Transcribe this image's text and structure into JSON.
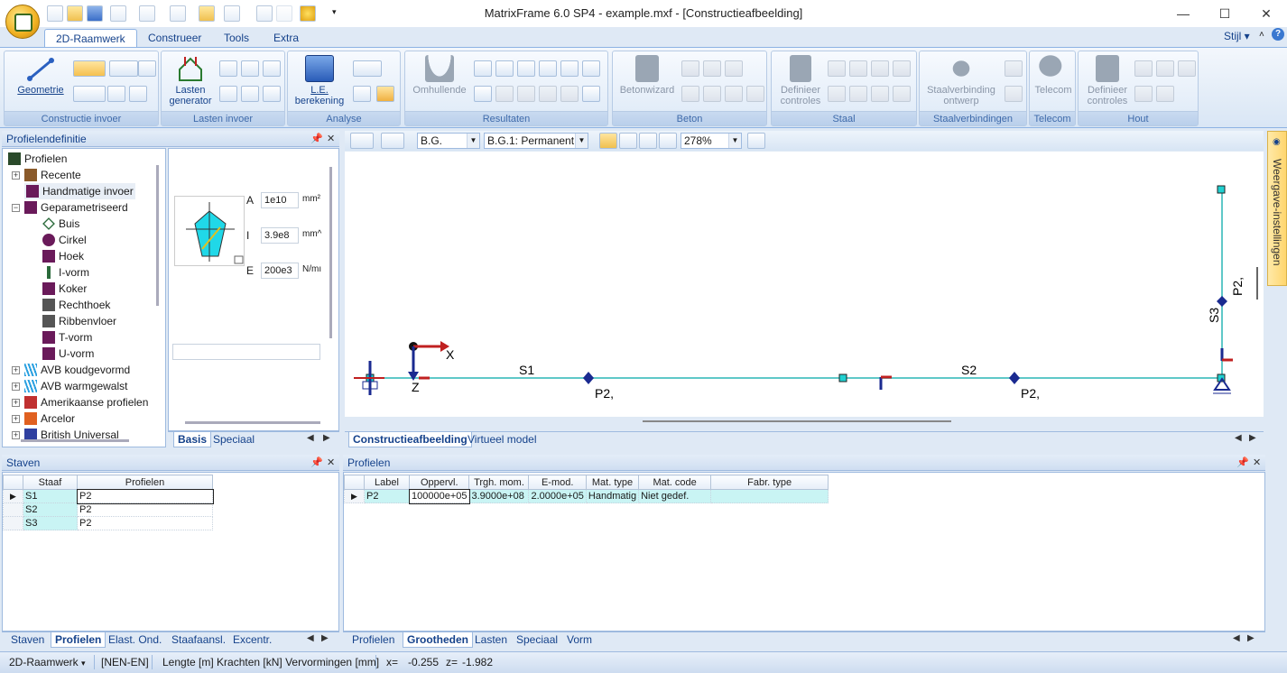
{
  "app": {
    "title": "MatrixFrame 6.0 SP4 - example.mxf - [Constructieafbeelding]",
    "stijl_label": "Stijl",
    "help_label": "?"
  },
  "window_controls": {
    "minimize": "—",
    "maximize": "☐",
    "close": "✕"
  },
  "ribbon_tabs": [
    {
      "label": "2D-Raamwerk",
      "active": true
    },
    {
      "label": "Construeer",
      "active": false
    },
    {
      "label": "Tools",
      "active": false
    },
    {
      "label": "Extra",
      "active": false
    }
  ],
  "ribbon_groups": {
    "constructie": {
      "label": "Constructie invoer",
      "big_button": "Geometrie"
    },
    "lasten": {
      "label": "Lasten invoer",
      "big_button_line1": "Lasten",
      "big_button_line2": "generator"
    },
    "analyse": {
      "label": "Analyse",
      "big_button_line1": "L.E.",
      "big_button_line2": "berekening"
    },
    "resultaten": {
      "label": "Resultaten",
      "big_button": "Omhullende"
    },
    "beton": {
      "label": "Beton",
      "big_button": "Betonwizard"
    },
    "staal": {
      "label": "Staal",
      "big_button_line1": "Definieer",
      "big_button_line2": "controles"
    },
    "staalverbindingen": {
      "label": "Staalverbindingen",
      "big_button_line1": "Staalverbinding",
      "big_button_line2": "ontwerp"
    },
    "telecom": {
      "label": "Telecom",
      "big_button": "Telecom"
    },
    "hout": {
      "label": "Hout",
      "big_button_line1": "Definieer",
      "big_button_line2": "controles"
    }
  },
  "profile_panel": {
    "title": "Profielendefinitie",
    "tree": [
      {
        "label": "Profielen",
        "level": 0,
        "icon": "profiles-grid-icon"
      },
      {
        "label": "Recente",
        "level": 1,
        "icon": "recent-icon",
        "expander": "+"
      },
      {
        "label": "Handmatige invoer",
        "level": 1,
        "icon": "manual-input-icon",
        "selected": true
      },
      {
        "label": "Geparametriseerd",
        "level": 1,
        "icon": "parametric-icon",
        "expander": "−"
      },
      {
        "label": "Buis",
        "level": 2,
        "icon": "tube-icon"
      },
      {
        "label": "Cirkel",
        "level": 2,
        "icon": "circle-icon"
      },
      {
        "label": "Hoek",
        "level": 2,
        "icon": "angle-icon"
      },
      {
        "label": "I-vorm",
        "level": 2,
        "icon": "i-shape-icon"
      },
      {
        "label": "Koker",
        "level": 2,
        "icon": "box-icon"
      },
      {
        "label": "Rechthoek",
        "level": 2,
        "icon": "rectangle-icon"
      },
      {
        "label": "Ribbenvloer",
        "level": 2,
        "icon": "ribbed-floor-icon"
      },
      {
        "label": "T-vorm",
        "level": 2,
        "icon": "t-shape-icon"
      },
      {
        "label": "U-vorm",
        "level": 2,
        "icon": "u-shape-icon"
      },
      {
        "label": "AVB koudgevormd",
        "level": 1,
        "icon": "cold-formed-icon",
        "expander": "+"
      },
      {
        "label": "AVB warmgewalst",
        "level": 1,
        "icon": "hot-rolled-icon",
        "expander": "+"
      },
      {
        "label": "Amerikaanse profielen",
        "level": 1,
        "icon": "us-flag-icon",
        "expander": "+"
      },
      {
        "label": "Arcelor",
        "level": 1,
        "icon": "arcelor-icon",
        "expander": "+"
      },
      {
        "label": "British Universal",
        "level": 1,
        "icon": "uk-flag-icon",
        "expander": "+"
      }
    ],
    "props": [
      {
        "key": "A",
        "value": "1e10",
        "unit": "mm²"
      },
      {
        "key": "I",
        "value": "3.9e8",
        "unit": "mm^"
      },
      {
        "key": "E",
        "value": "200e3",
        "unit": "N/mı"
      }
    ],
    "tabs": [
      {
        "label": "Basis",
        "active": true
      },
      {
        "label": "Speciaal",
        "active": false
      }
    ]
  },
  "view_toolbar": {
    "loadcase": "B.G.",
    "combination": "B.G.1: Permanent",
    "zoom": "278%"
  },
  "canvas": {
    "labels": {
      "s1": "S1",
      "s2": "S2",
      "s3": "S3",
      "p2a": "P2,",
      "p2b": "P2,",
      "p2c": "P2,",
      "x_axis": "X",
      "z_axis": "Z"
    }
  },
  "view_tabs": [
    {
      "label": "Constructieafbeelding",
      "active": true
    },
    {
      "label": "Virtueel model",
      "active": false
    }
  ],
  "right_sidebar": {
    "label": "Weergave-instellingen"
  },
  "staven_panel": {
    "title": "Staven",
    "columns": [
      "Staaf",
      "Profielen"
    ],
    "rows": [
      {
        "staaf": "S1",
        "profiel": "P2"
      },
      {
        "staaf": "S2",
        "profiel": "P2"
      },
      {
        "staaf": "S3",
        "profiel": "P2"
      }
    ],
    "tabs": [
      {
        "label": "Staven",
        "active": false
      },
      {
        "label": "Profielen",
        "active": true
      },
      {
        "label": "Elast. Ond.",
        "active": false
      },
      {
        "label": "Staafaansl.",
        "active": false
      },
      {
        "label": "Excentr.",
        "active": false
      }
    ]
  },
  "profielen_panel": {
    "title": "Profielen",
    "columns": [
      "Label",
      "Oppervl.",
      "Trgh. mom.",
      "E-mod.",
      "Mat. type",
      "Mat. code",
      "Fabr. type"
    ],
    "rows": [
      {
        "label": "P2",
        "oppervl": "100000e+05",
        "trgh": "3.9000e+08",
        "emod": "2.0000e+05",
        "mattype": "Handmatig",
        "matcode": "Niet gedef.",
        "fabr": ""
      }
    ],
    "tabs": [
      {
        "label": "Profielen",
        "active": false
      },
      {
        "label": "Grootheden",
        "active": true
      },
      {
        "label": "Lasten",
        "active": false
      },
      {
        "label": "Speciaal",
        "active": false
      },
      {
        "label": "Vorm",
        "active": false
      }
    ]
  },
  "statusbar": {
    "mode": "2D-Raamwerk",
    "code": "[NEN-EN]",
    "units": "Lengte [m] Krachten [kN] Vervormingen [mm]",
    "coord_label": "x=",
    "coord_x": "-0.255",
    "coord_z_label": "z=",
    "coord_z": "-1.982"
  },
  "colors": {
    "accent": "#15428b",
    "member": "#5fc8c8",
    "node": "#20d0d0",
    "support": "#1a2a90",
    "selected_row": "#c9f4f4"
  }
}
